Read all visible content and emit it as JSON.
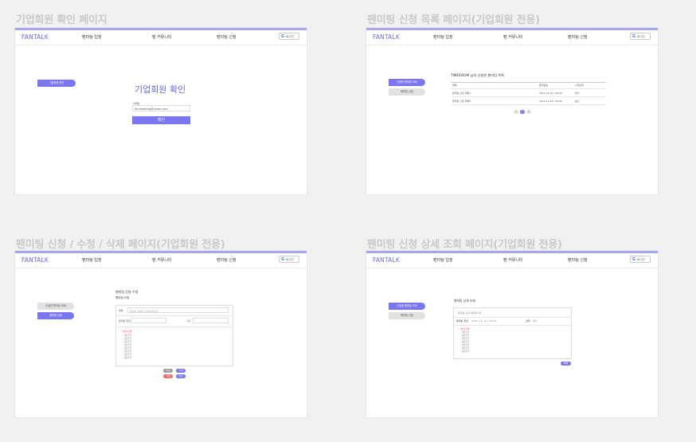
{
  "page_titles": [
    "기업회원 확인 페이지",
    "팬미팅 신청 목록 페이지(기업회원 전용)",
    "팬미팅 신청 / 수정 / 삭제 페이지(기업회원 전용)",
    "팬미팅 신청 상세 조회 페이지(기업회원 전용)"
  ],
  "header": {
    "logo": "FANTALK",
    "nav": [
      "팬미팅 입장",
      "팬 커뮤니티",
      "팬미팅 신청"
    ],
    "login": "로그인",
    "google_glyph": "G"
  },
  "colors": {
    "accent": "#7a75f0",
    "topbar": "#a7a6f5",
    "bg": "#f1f1f1"
  },
  "f1": {
    "side": "기업회원 확인",
    "heading": "기업회원 확인",
    "label": "이메일",
    "email": "fanmeeting@naver.com",
    "submit": "확인"
  },
  "f2": {
    "side": [
      "신청한 팬미팅 조회",
      "팬미팅 신청"
    ],
    "title": "TIMEROOM 님의 신청한 팬미팅 목록",
    "cols": [
      "제목",
      "팬미팅일",
      "신청상태"
    ],
    "rows": [
      [
        "팬미팅 신청 제목1",
        "2022.11.15 / 18:00",
        "대기"
      ],
      [
        "팬미팅 신청 제목2",
        "2022.11.22 / 19:00",
        "승인"
      ]
    ],
    "pages": [
      "<",
      "1",
      ">"
    ]
  },
  "f3": {
    "side": [
      "신청한 팬미팅 조회",
      "팬미팅 신청"
    ],
    "title": "팬미팅 신청 수정",
    "subtitle": "팬미팅 신청",
    "title_label": "제목",
    "title_placeholder": "팬미팅 제목을 입력해주세요",
    "date_label": "팬미팅 일정",
    "time_label": "시간",
    "notice": "* 유의사항",
    "lines": [
      "- 내용입력",
      "- 내용입력",
      "- 내용입력",
      "- 내용입력",
      "- 내용입력",
      "- 내용입력",
      "- 내용입력",
      "- 내용입력"
    ],
    "buttons": [
      "취소",
      "수정",
      "삭제",
      "확인"
    ]
  },
  "f4": {
    "side": [
      "신청한 팬미팅 조회",
      "팬미팅 신청"
    ],
    "title": "팬미팅 상세 조회",
    "subject": "팬미팅 신청 제목입니다",
    "date_label": "팬미팅 일정",
    "date_value": "2022. 11. 15 / 18:00",
    "status_label": "상태",
    "status_value": "대기",
    "notice": "* 유의사항",
    "lines": [
      "- 내용입력",
      "- 내용입력",
      "- 내용입력",
      "- 내용입력",
      "- 내용입력",
      "- 내용입력",
      "- 내용입력"
    ],
    "back": "목록"
  }
}
